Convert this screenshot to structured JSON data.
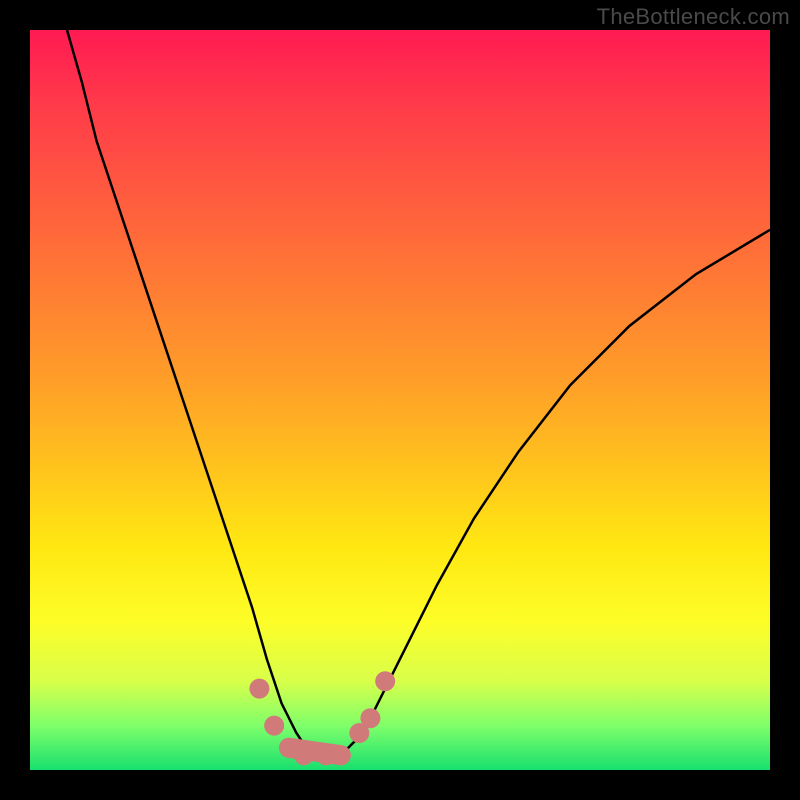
{
  "watermark": "TheBottleneck.com",
  "colors": {
    "background": "#000000",
    "gradient_top": "#ff1a52",
    "gradient_mid1": "#ff7a34",
    "gradient_mid2": "#ffe812",
    "gradient_bottom": "#18e06e",
    "curve": "#000000",
    "markers": "#d17a7a"
  },
  "chart_data": {
    "type": "line",
    "title": "",
    "xlabel": "",
    "ylabel": "",
    "xlim": [
      0,
      100
    ],
    "ylim": [
      0,
      100
    ],
    "grid": false,
    "legend": false,
    "markers": {
      "color": "#d17a7a",
      "x_range": [
        31,
        48
      ],
      "points": [
        {
          "x": 31,
          "y": 11
        },
        {
          "x": 33,
          "y": 6
        },
        {
          "x": 35,
          "y": 3
        },
        {
          "x": 37,
          "y": 2
        },
        {
          "x": 40,
          "y": 2
        },
        {
          "x": 42,
          "y": 2
        },
        {
          "x": 44.5,
          "y": 5
        },
        {
          "x": 46,
          "y": 7
        },
        {
          "x": 48,
          "y": 12
        }
      ]
    },
    "series": [
      {
        "name": "bottleneck-curve",
        "x": [
          5,
          7,
          9,
          12,
          15,
          18,
          21,
          24,
          27,
          30,
          32,
          34,
          36,
          38,
          40,
          42,
          44,
          46,
          48,
          51,
          55,
          60,
          66,
          73,
          81,
          90,
          100
        ],
        "y": [
          100,
          93,
          85,
          76,
          67,
          58,
          49,
          40,
          31,
          22,
          15,
          9,
          5,
          2,
          1,
          2,
          4,
          7,
          11,
          17,
          25,
          34,
          43,
          52,
          60,
          67,
          73
        ]
      }
    ]
  }
}
